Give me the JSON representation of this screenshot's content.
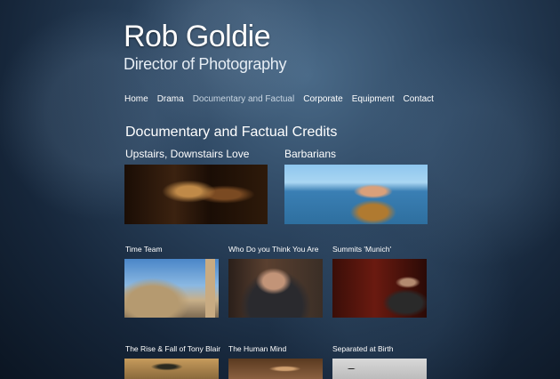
{
  "site": {
    "title": "Rob Goldie",
    "subtitle": "Director of Photography"
  },
  "nav": {
    "items": [
      "Home",
      "Drama",
      "Documentary and Factual",
      "Corporate",
      "Equipment",
      "Contact"
    ],
    "active": "Documentary and Factual"
  },
  "page": {
    "heading": "Documentary and Factual Credits"
  },
  "featured": [
    {
      "title": "Upstairs, Downstairs Love"
    },
    {
      "title": "Barbarians"
    }
  ],
  "credits_row1": [
    {
      "title": "Time Team"
    },
    {
      "title": "Who Do you Think You Are"
    },
    {
      "title": "Summits 'Munich'"
    }
  ],
  "credits_row2": [
    {
      "title": "The Rise & Fall of Tony Blair"
    },
    {
      "title": "The Human Mind"
    },
    {
      "title": "Separated at Birth"
    }
  ]
}
